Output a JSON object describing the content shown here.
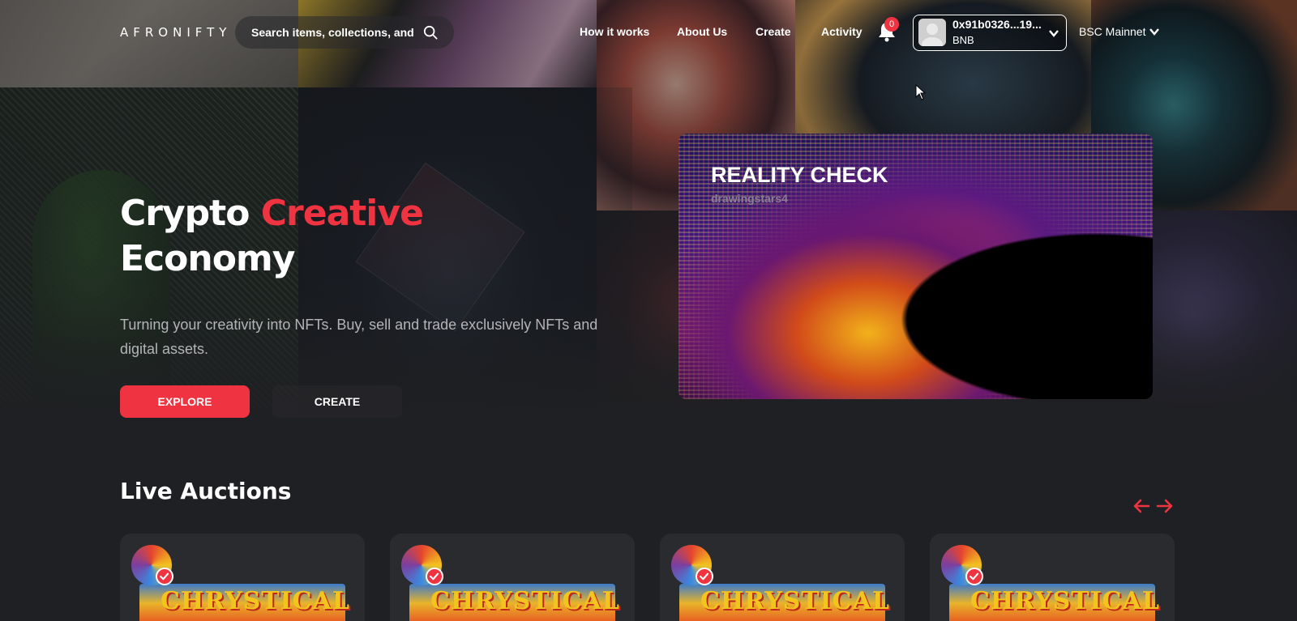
{
  "header": {
    "logo": "AFRONIFTY",
    "search_placeholder": "Search items, collections, and accounts",
    "nav": [
      "How it works",
      "About Us",
      "Create",
      "Activity"
    ],
    "notification_count": "0",
    "wallet": {
      "address": "0x91b0326...19...",
      "network": "BNB"
    },
    "network_selector": "BSC Mainnet"
  },
  "hero": {
    "title_part1": "Crypto ",
    "title_accent": "Creative",
    "title_part2": "Economy",
    "subtitle": "Turning your creativity into NFTs. Buy, sell and trade exclusively NFTs and digital assets.",
    "explore_label": "EXPLORE",
    "create_label": "CREATE"
  },
  "featured": {
    "title": "REALITY CHECK",
    "author": "drawingstars4"
  },
  "live_auctions": {
    "title": "Live Auctions",
    "cards": [
      {
        "image_text": "CHRYSTICAL"
      },
      {
        "image_text": "CHRYSTICAL"
      },
      {
        "image_text": "CHRYSTICAL"
      },
      {
        "image_text": "CHRYSTICAL"
      }
    ]
  },
  "colors": {
    "accent": "#ef3340",
    "background": "#1f2023",
    "card": "#2a2b2f"
  }
}
